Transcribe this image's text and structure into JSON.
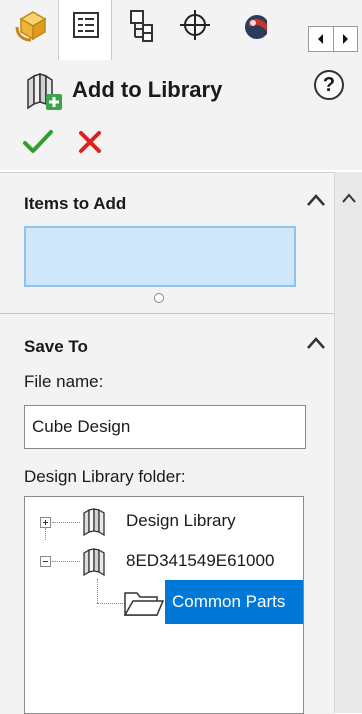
{
  "tabs": [
    {
      "name": "featuremanager-tab",
      "icon": "cube-icon"
    },
    {
      "name": "propertymanager-tab",
      "icon": "property-list-icon",
      "active": true
    },
    {
      "name": "configurationmanager-tab",
      "icon": "configuration-tree-icon"
    },
    {
      "name": "dimxpert-tab",
      "icon": "crosshair-icon"
    },
    {
      "name": "display-manager-tab",
      "icon": "appearance-sphere-icon"
    }
  ],
  "header": {
    "title": "Add to Library",
    "help_label": "?",
    "ok_icon": "green-checkmark-icon",
    "cancel_icon": "red-x-icon"
  },
  "items_to_add": {
    "title": "Items to Add"
  },
  "save_to": {
    "title": "Save To",
    "file_name_label": "File name:",
    "file_name_value": "Cube Design",
    "folder_label": "Design Library folder:"
  },
  "tree": {
    "nodes": [
      {
        "label": "Design Library",
        "expander": "+",
        "icon": "library-books-icon"
      },
      {
        "label": "8ED341549E61000",
        "expander": "-",
        "icon": "library-books-icon"
      },
      {
        "label": "Common Parts",
        "icon": "folder-icon",
        "selected": true
      }
    ]
  },
  "colors": {
    "selection": "#0078d7",
    "items_box_fill": "#cfe6fb",
    "ok": "#2e9e2e",
    "cancel": "#e0201b"
  }
}
